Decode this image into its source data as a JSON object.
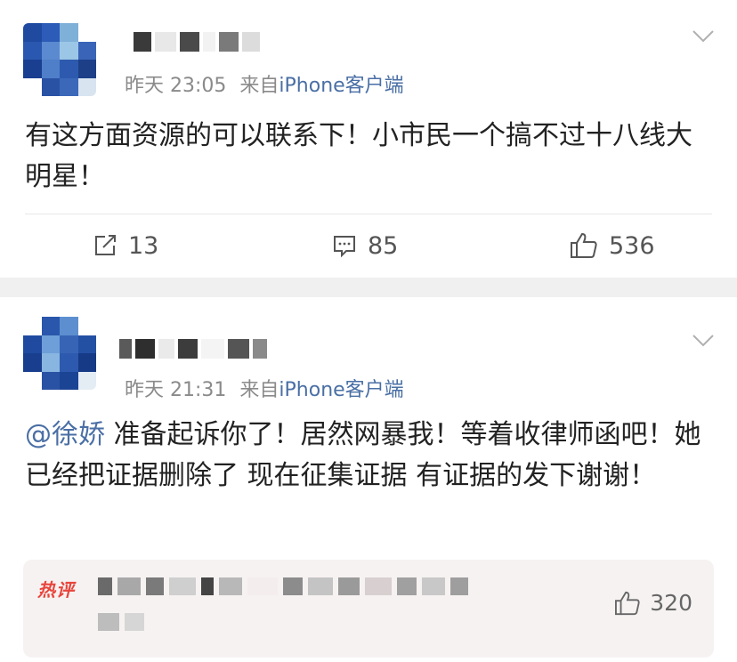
{
  "posts": [
    {
      "time": "昨天 23:05",
      "source_prefix": "来自",
      "source": "iPhone客户端",
      "content": "有这方面资源的可以联系下！小市民一个搞不过十八线大明星！",
      "actions": {
        "repost_count": "13",
        "comment_count": "85",
        "like_count": "536"
      }
    },
    {
      "time": "昨天 21:31",
      "source_prefix": "来自",
      "source": "iPhone客户端",
      "mention": "@徐娇",
      "content": " 准备起诉你了！居然网暴我！等着收律师函吧！她已经把证据删除了 现在征集证据 有证据的发下谢谢！",
      "hot_comment": {
        "tag": "热评",
        "like_count": "320"
      }
    }
  ],
  "icons": [
    "chevron-down-icon",
    "repost-icon",
    "comment-icon",
    "like-icon"
  ],
  "colors": {
    "link": "#4a6fa5",
    "meta": "#8a8a8a",
    "hot_tag": "#e8453c",
    "divider": "#f0f0f0",
    "hot_bg": "#f7f2f2"
  }
}
